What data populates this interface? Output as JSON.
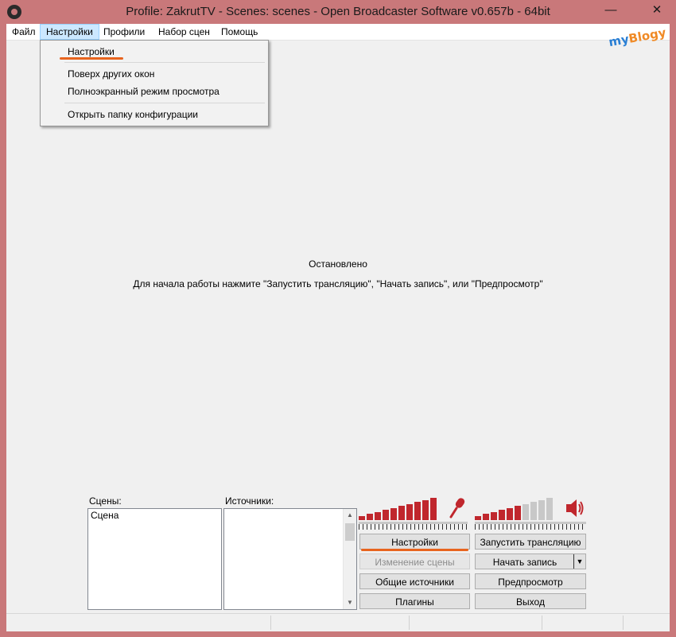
{
  "window": {
    "title": "Profile: ZakrutTV - Scenes: scenes - Open Broadcaster Software v0.657b - 64bit",
    "minimize_glyph": "—",
    "close_glyph": "✕"
  },
  "menu": {
    "items": [
      "Файл",
      "Настройки",
      "Профили",
      "Набор сцен",
      "Помощь"
    ],
    "active_index": 1
  },
  "dropdown": {
    "items": [
      "Настройки",
      "Поверх других окон",
      "Полноэкранный режим просмотра",
      "Открыть папку конфигурации"
    ]
  },
  "watermark": {
    "part1": "my",
    "part2": "Blogy"
  },
  "preview": {
    "status": "Остановлено",
    "hint": "Для начала работы нажмите \"Запустить трансляцию\", \"Начать запись\", или \"Предпросмотр\""
  },
  "scenes": {
    "label": "Сцены:",
    "items": [
      "Сцена"
    ]
  },
  "sources": {
    "label": "Источники:",
    "items": []
  },
  "meters": {
    "mic": {
      "level_bars": 10,
      "total_bars": 10,
      "icon": "microphone-icon"
    },
    "desktop": {
      "level_bars": 6,
      "total_bars": 10,
      "icon": "speaker-icon"
    }
  },
  "buttons": {
    "settings": "Настройки",
    "start_stream": "Запустить трансляцию",
    "edit_scene": "Изменение сцены",
    "start_record": "Начать запись",
    "global_sources": "Общие источники",
    "preview": "Предпросмотр",
    "plugins": "Плагины",
    "exit": "Выход"
  },
  "colors": {
    "window_frame": "#c9787a",
    "meter_active": "#c0272d",
    "meter_inactive": "#c8c8c8",
    "highlight_underline": "#e8641e",
    "menu_active": "#cce8ff"
  }
}
